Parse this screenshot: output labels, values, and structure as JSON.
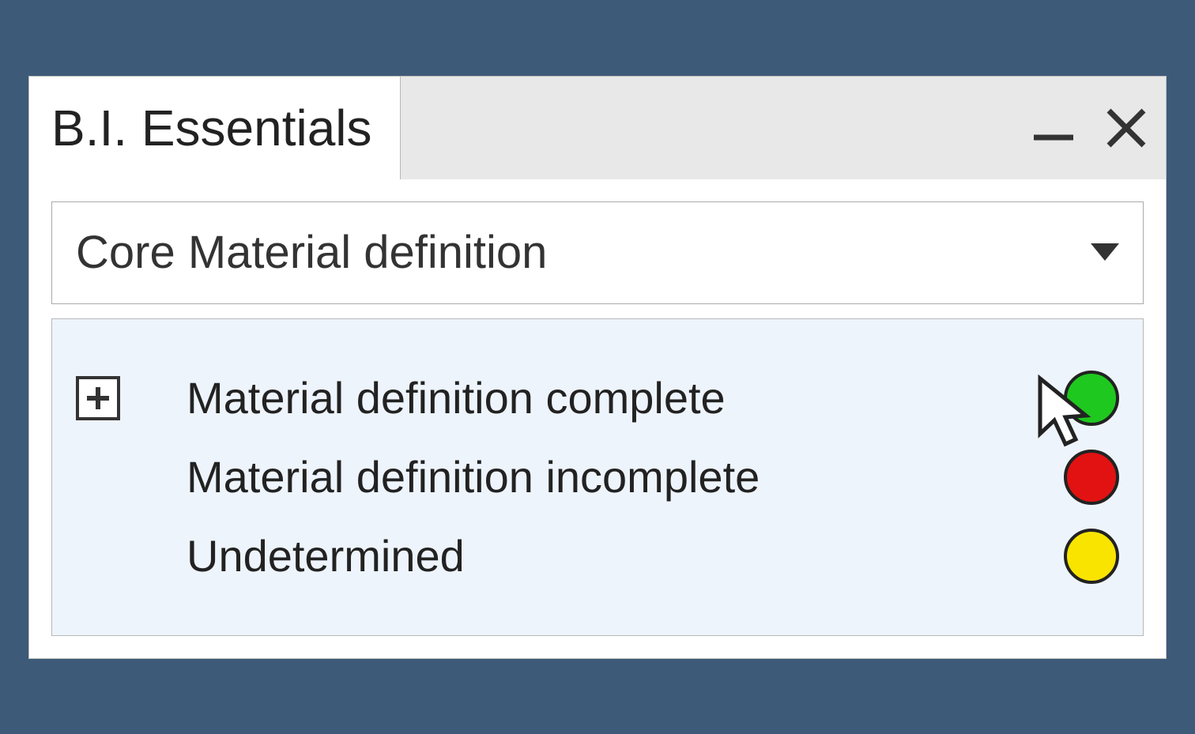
{
  "panel": {
    "title": "B.I. Essentials"
  },
  "dropdown": {
    "selected": "Core Material definition"
  },
  "legend": {
    "items": [
      {
        "label": "Material definition complete",
        "color": "#1ec81e",
        "hasExpand": true
      },
      {
        "label": "Material definition incomplete",
        "color": "#e21212",
        "hasExpand": false
      },
      {
        "label": "Undetermined",
        "color": "#f9e400",
        "hasExpand": false
      }
    ]
  }
}
